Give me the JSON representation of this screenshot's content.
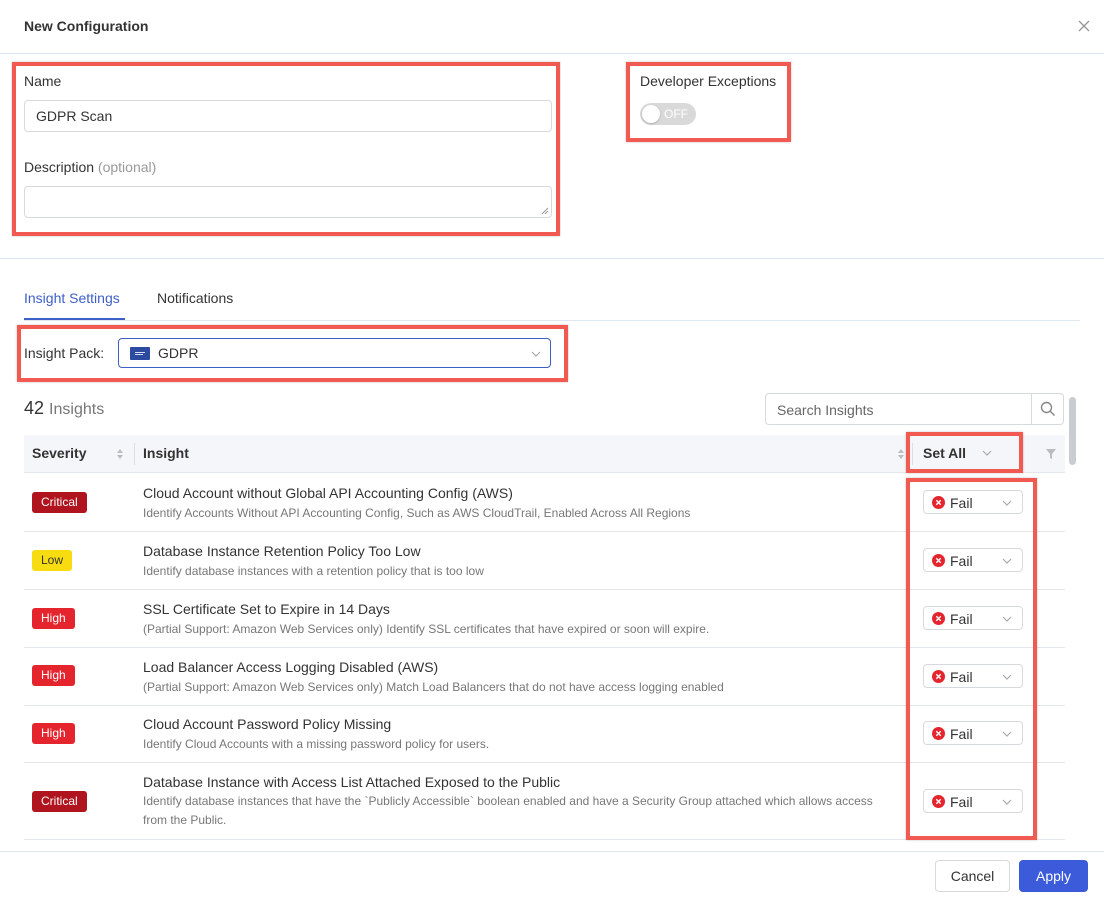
{
  "header": {
    "title": "New Configuration",
    "close_icon": "close-icon"
  },
  "form": {
    "name_label": "Name",
    "name_value": "GDPR Scan",
    "description_label": "Description",
    "description_optional": "(optional)",
    "description_value": "",
    "developer_exceptions_label": "Developer Exceptions",
    "developer_exceptions_state": "OFF"
  },
  "tabs": [
    {
      "label": "Insight Settings",
      "active": true
    },
    {
      "label": "Notifications",
      "active": false
    }
  ],
  "insight_pack": {
    "label": "Insight Pack",
    "colon": ":",
    "value": "GDPR",
    "icon": "eu-flag-icon"
  },
  "insights": {
    "count": "42",
    "count_label": "Insights",
    "search_placeholder": "Search Insights"
  },
  "table": {
    "columns": {
      "severity": "Severity",
      "insight": "Insight",
      "set_all": "Set All"
    },
    "rows": [
      {
        "severity": "Critical",
        "level": "critical",
        "title": "Cloud Account without Global API Accounting Config (AWS)",
        "description": "Identify Accounts Without API Accounting Config, Such as AWS CloudTrail, Enabled Across All Regions",
        "action": "Fail"
      },
      {
        "severity": "Low",
        "level": "low",
        "title": "Database Instance Retention Policy Too Low",
        "description": "Identify database instances with a retention policy that is too low",
        "action": "Fail"
      },
      {
        "severity": "High",
        "level": "high",
        "title": "SSL Certificate Set to Expire in 14 Days",
        "description": "(Partial Support: Amazon Web Services only) Identify SSL certificates that have expired or soon will expire.",
        "action": "Fail"
      },
      {
        "severity": "High",
        "level": "high",
        "title": "Load Balancer Access Logging Disabled (AWS)",
        "description": "(Partial Support: Amazon Web Services only) Match Load Balancers that do not have access logging enabled",
        "action": "Fail"
      },
      {
        "severity": "High",
        "level": "high",
        "title": "Cloud Account Password Policy Missing",
        "description": "Identify Cloud Accounts with a missing password policy for users.",
        "action": "Fail"
      },
      {
        "severity": "Critical",
        "level": "critical",
        "title": "Database Instance with Access List Attached Exposed to the Public",
        "description": "Identify database instances that have the `Publicly Accessible` boolean enabled and have a Security Group attached which allows access from the Public.",
        "action": "Fail"
      }
    ]
  },
  "footer": {
    "cancel": "Cancel",
    "apply": "Apply"
  },
  "colors": {
    "accent": "#3e5fc7",
    "apply": "#3b5bdb",
    "critical": "#b0141e",
    "high": "#e5252e",
    "low": "#f6dc10",
    "annotation_box": "#f05a50"
  }
}
